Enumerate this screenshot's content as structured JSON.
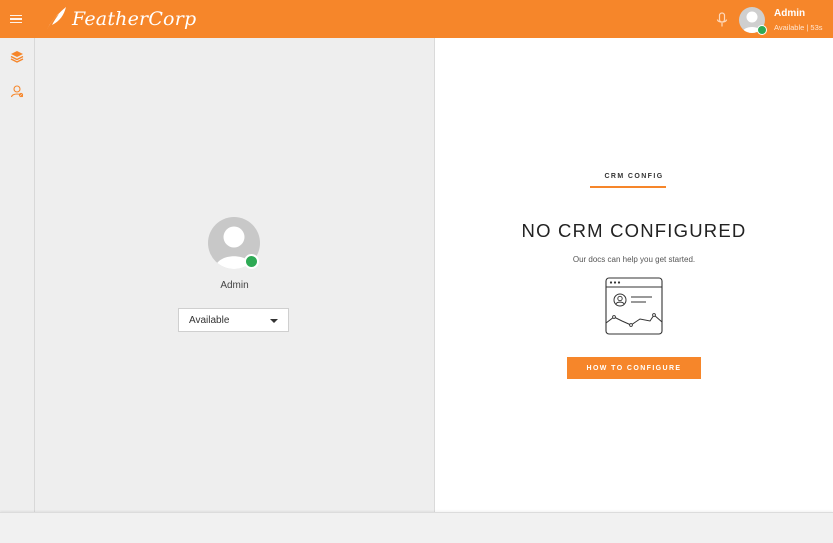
{
  "header": {
    "brand": "FeatherCorp",
    "user_name": "Admin",
    "user_status_line": "Available | 53s"
  },
  "agent": {
    "name": "Admin",
    "status_selected": "Available"
  },
  "crm": {
    "section_heading": "CRM CONFIG",
    "title": "NO CRM CONFIGURED",
    "subtitle": "Our docs can help you get started.",
    "button_label": "HOW TO CONFIGURE"
  },
  "icons": {
    "menu": "hamburger-menu-icon",
    "logo": "feather-icon",
    "mic": "microphone-icon",
    "rail_1": "layers-icon",
    "rail_2": "contacts-icon",
    "illustration": "profile-chart-illustration"
  },
  "colors": {
    "brand_orange": "#f6862a",
    "status_green": "#2eaa55",
    "panel_gray": "#eeeeee"
  }
}
